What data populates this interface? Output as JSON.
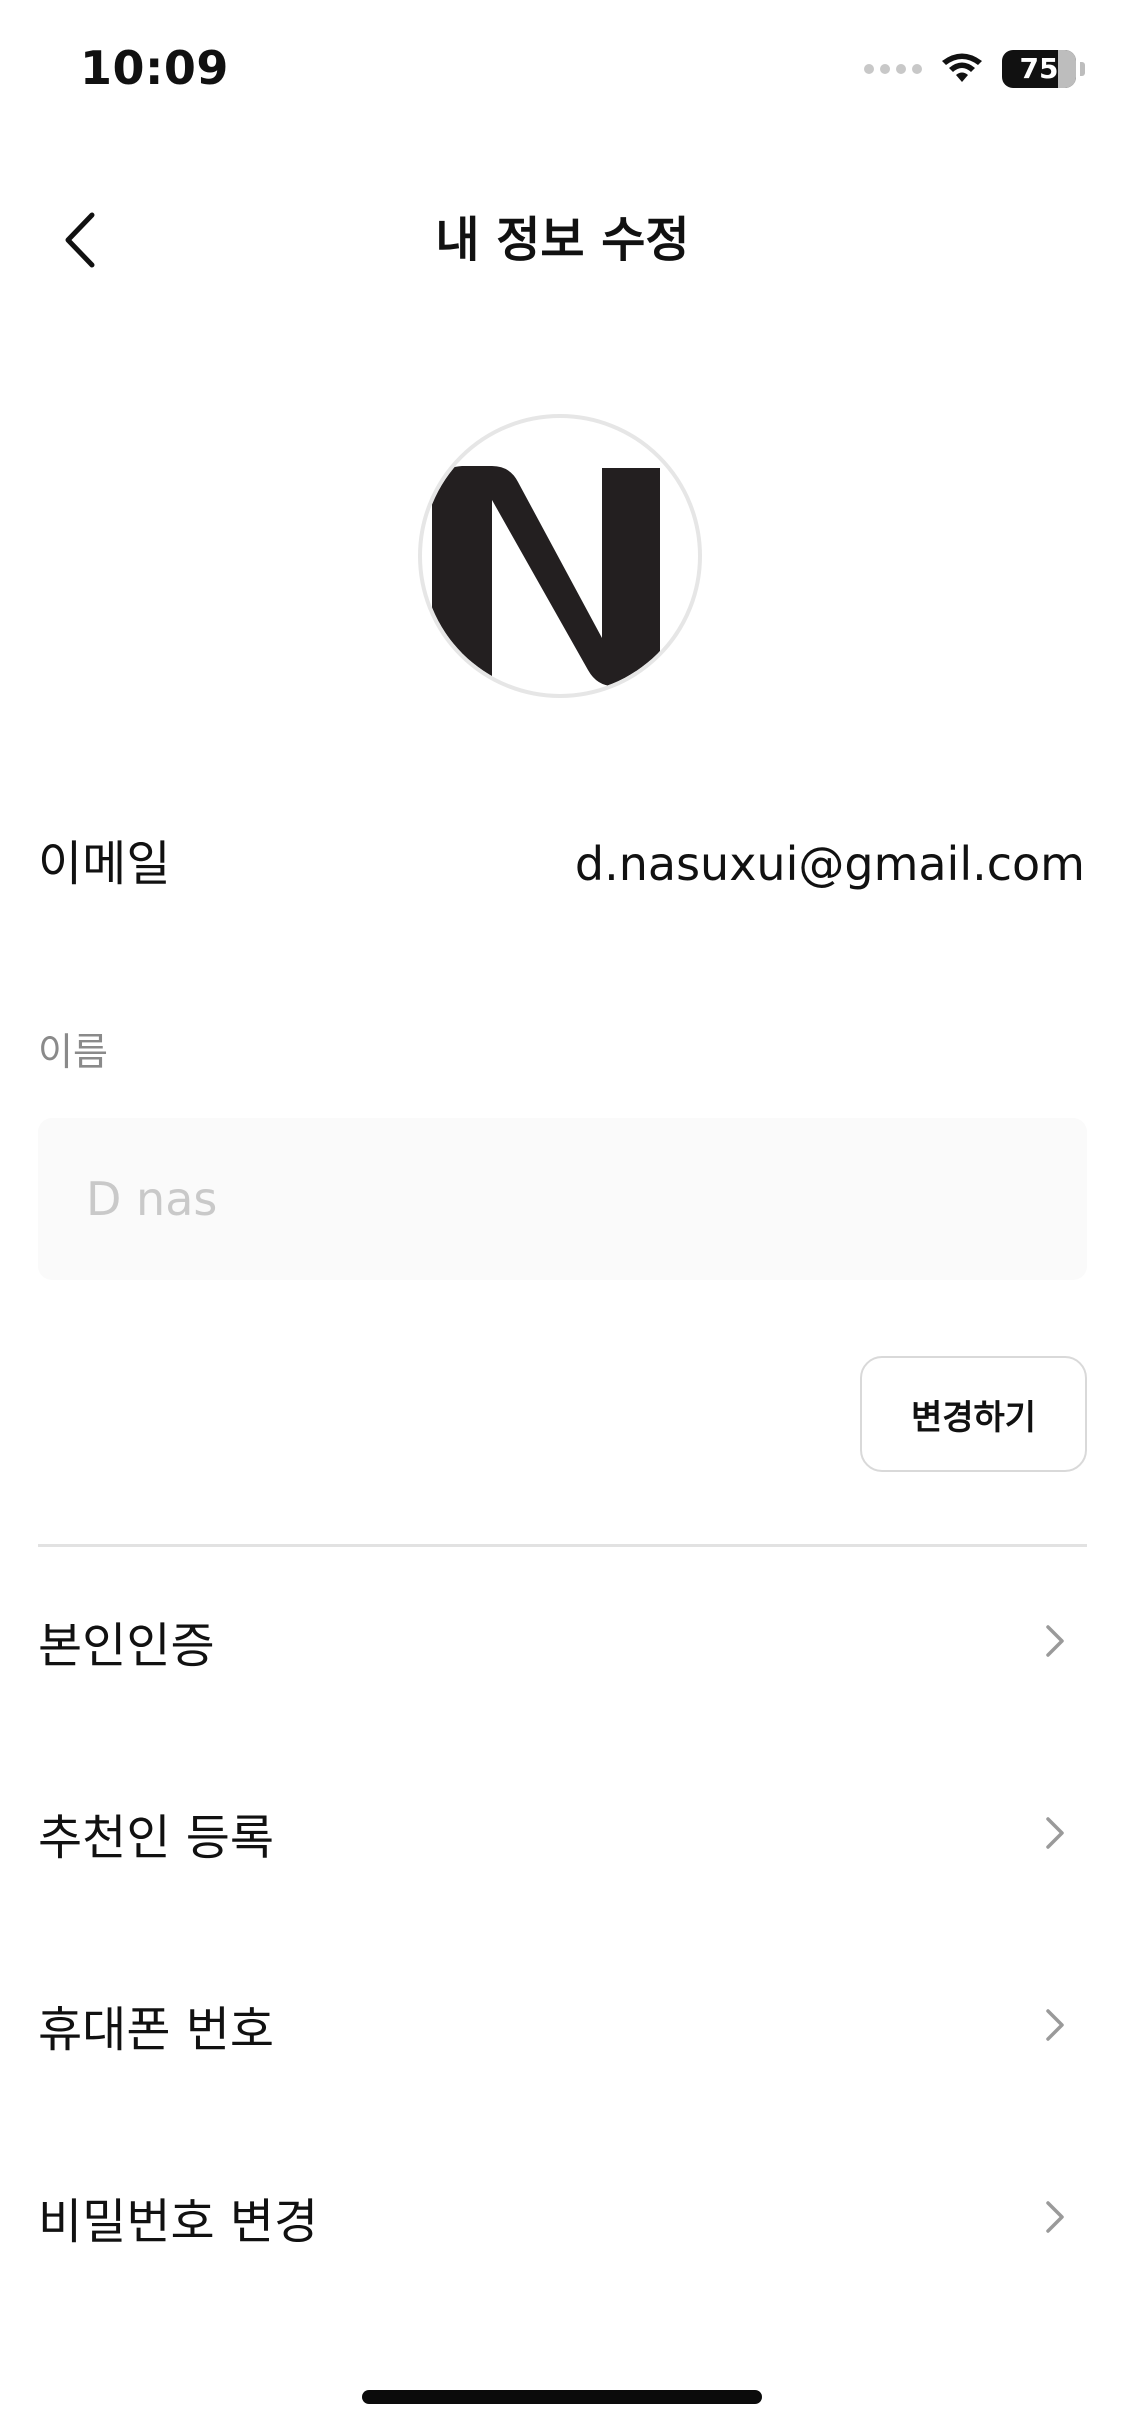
{
  "status_bar": {
    "time": "10:09",
    "battery_percent": "75"
  },
  "header": {
    "title": "내 정보 수정"
  },
  "profile": {
    "avatar_letter_icon": "n-logo-icon"
  },
  "email": {
    "label": "이메일",
    "value": "d.nasuxui@gmail.com"
  },
  "name": {
    "label": "이름",
    "placeholder": "D nas",
    "change_button": "변경하기"
  },
  "menu": [
    {
      "label": "본인인증",
      "icon": "chevron-right-icon"
    },
    {
      "label": "추천인 등록",
      "icon": "chevron-right-icon"
    },
    {
      "label": "휴대폰 번호",
      "icon": "chevron-right-icon"
    },
    {
      "label": "비밀번호 변경",
      "icon": "chevron-right-icon"
    }
  ],
  "colors": {
    "text": "#111111",
    "muted": "#8a8a8a",
    "placeholder": "#c9c9c9",
    "divider": "#e2e2e2",
    "input_bg": "#fafafa"
  }
}
